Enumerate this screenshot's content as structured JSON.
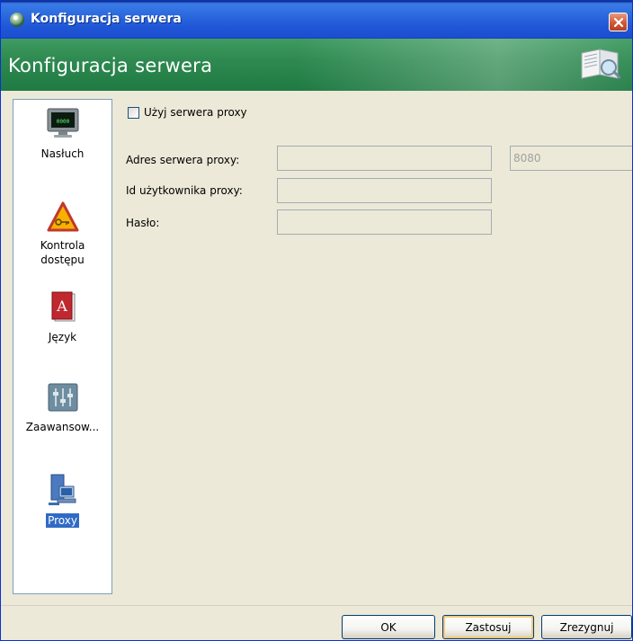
{
  "window": {
    "title": "Konfiguracja serwera",
    "close_icon": "close-icon"
  },
  "banner": {
    "title": "Konfiguracja serwera",
    "icon": "config-search-icon"
  },
  "sidebar": {
    "items": [
      {
        "label": "Nasłuch",
        "icon": "monitor-icon",
        "selected": false
      },
      {
        "label": "Kontrola\ndostępu",
        "icon": "warning-key-icon",
        "selected": false
      },
      {
        "label": "Język",
        "icon": "language-book-icon",
        "selected": false
      },
      {
        "label": "Zaawansow...",
        "icon": "sliders-icon",
        "selected": false
      },
      {
        "label": "Proxy",
        "icon": "proxy-computer-icon",
        "selected": true
      }
    ]
  },
  "form": {
    "use_proxy_label": "Użyj serwera proxy",
    "use_proxy_checked": false,
    "address_label": "Adres serwera proxy:",
    "address_value": "",
    "port_value": "8080",
    "user_label": "Id użytkownika proxy:",
    "user_value": "",
    "password_label": "Hasło:",
    "password_value": ""
  },
  "buttons": {
    "ok": "OK",
    "apply": "Zastosuj",
    "cancel": "Zrezygnuj"
  },
  "colors": {
    "titlebar": "#2f6fe0",
    "banner": "#2f8a51",
    "selection": "#316ac5",
    "window_bg": "#ece9d8"
  }
}
